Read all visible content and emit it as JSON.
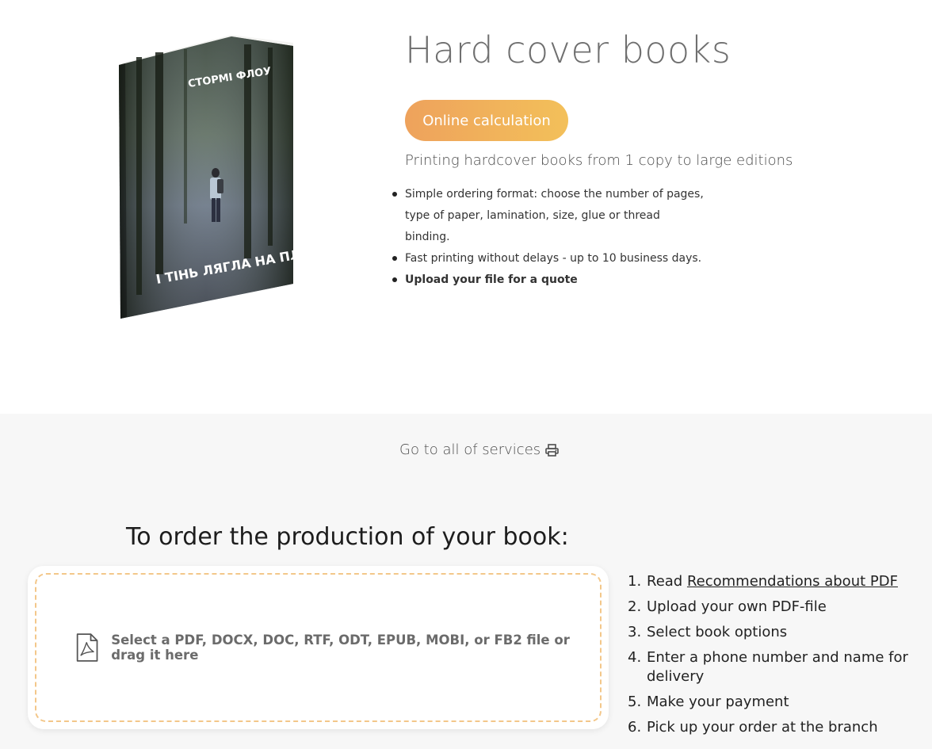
{
  "product": {
    "title": "Hard cover books",
    "calc_button": "Online calculation",
    "subtitle": "Printing hardcover books from 1 copy to large editions",
    "features": [
      "Simple ordering format: choose the number of pages, type of paper, lamination, size, glue or thread binding.",
      "Fast printing without delays - up to 10 business days.",
      "Upload your file for a quote"
    ]
  },
  "book_cover": {
    "author": "СТОРМІ ФЛОУ",
    "title": "І ТІНЬ ЛЯГЛА НА ПЛЕЧІ"
  },
  "services": {
    "link_text": "Go to all of services",
    "icon": "printer-icon"
  },
  "order": {
    "heading": "To order the production of your book:",
    "upload_text": "Select a PDF, DOCX, DOC, RTF, ODT, EPUB, MOBI, or FB2 file or drag it here",
    "upload_icon": "pdf-file-icon",
    "steps": [
      {
        "num": "1.",
        "prefix": "Read ",
        "link": "Recommendations about PDF"
      },
      {
        "num": "2.",
        "text": "Upload your own PDF-file"
      },
      {
        "num": "3.",
        "text": "Select book options"
      },
      {
        "num": "4.",
        "text": "Enter a phone number and name for delivery"
      },
      {
        "num": "5.",
        "text": "Make your payment"
      },
      {
        "num": "6.",
        "text": "Pick up your order at the branch"
      }
    ]
  },
  "colors": {
    "accent_start": "#eea25c",
    "accent_end": "#f3c05a",
    "dashed_border": "#f3c78a",
    "band_bg": "#f7f7f7"
  }
}
